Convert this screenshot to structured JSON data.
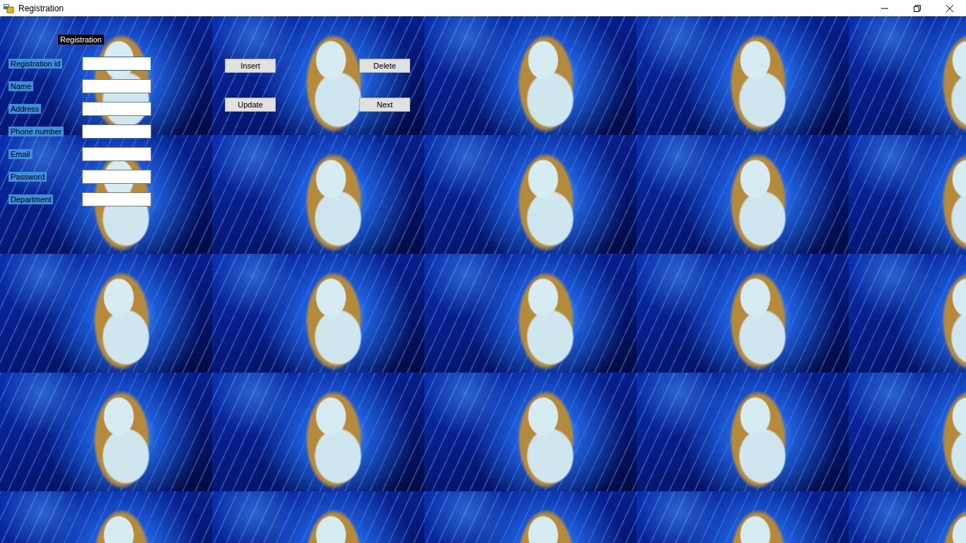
{
  "window": {
    "title": "Registration"
  },
  "heading": "Registration",
  "fields": [
    {
      "label": "Registration id",
      "value": "",
      "focused": true
    },
    {
      "label": "Name",
      "value": "",
      "focused": false
    },
    {
      "label": "Address",
      "value": "",
      "focused": false
    },
    {
      "label": "Phone number",
      "value": "",
      "focused": false
    },
    {
      "label": "Email",
      "value": "",
      "focused": false
    },
    {
      "label": "Password",
      "value": "",
      "focused": false
    },
    {
      "label": "Department",
      "value": "",
      "focused": false
    }
  ],
  "buttons": [
    "Insert",
    "Delete",
    "Update",
    "Next"
  ]
}
